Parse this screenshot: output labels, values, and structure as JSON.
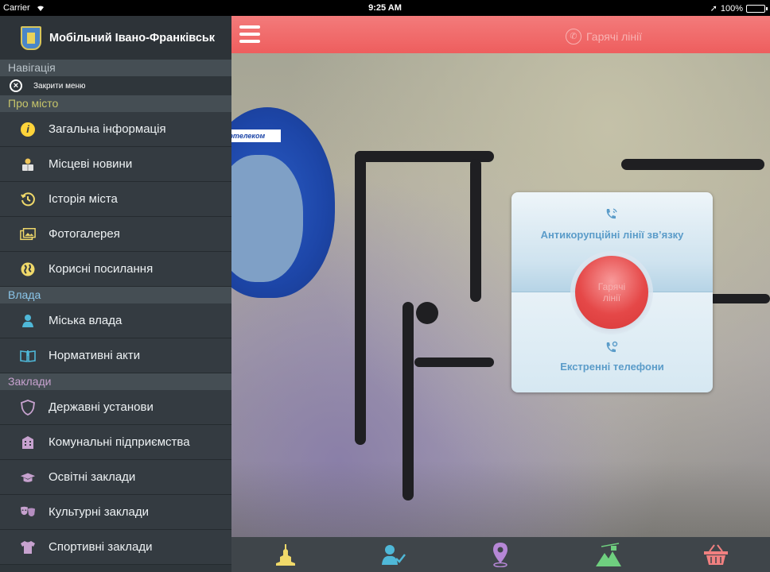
{
  "status_bar": {
    "carrier": "Carrier",
    "time": "9:25 AM",
    "battery": "100%"
  },
  "sidebar": {
    "app_title": "Мобільний Івано-Франківськ",
    "nav_section": "Навігація",
    "close_menu": "Закрити меню",
    "sections": [
      {
        "title": "Про місто",
        "items": [
          {
            "label": "Загальна інформація",
            "icon": "info-icon"
          },
          {
            "label": "Місцеві новини",
            "icon": "news-reader-icon"
          },
          {
            "label": "Історія міста",
            "icon": "history-clock-icon"
          },
          {
            "label": "Фотогалерея",
            "icon": "photo-gallery-icon"
          },
          {
            "label": "Корисні посилання",
            "icon": "globe-icon"
          }
        ]
      },
      {
        "title": "Влада",
        "items": [
          {
            "label": "Міська влада",
            "icon": "person-icon"
          },
          {
            "label": "Нормативні акти",
            "icon": "open-book-icon"
          }
        ]
      },
      {
        "title": "Заклади",
        "items": [
          {
            "label": "Державні установи",
            "icon": "shield-icon"
          },
          {
            "label": "Комунальні підприємства",
            "icon": "building-icon"
          },
          {
            "label": "Освітні заклади",
            "icon": "graduation-cap-icon"
          },
          {
            "label": "Культурні заклади",
            "icon": "theater-masks-icon"
          },
          {
            "label": "Спортивні заклади",
            "icon": "tshirt-icon"
          }
        ]
      }
    ]
  },
  "topbar": {
    "title": "Гарячі лінії"
  },
  "card": {
    "top_label": "Антикорупційні лінії зв’язку",
    "bottom_label": "Екстренні телефони",
    "center_button": "Гарячі лінії"
  },
  "colors": {
    "accent_red": "#ee5e5e",
    "card_blue": "#5b9cc9",
    "sidebar_bg": "#2f363b"
  },
  "tabbar": {
    "tabs": [
      {
        "name": "landmark-icon",
        "color": "#f0d96a"
      },
      {
        "name": "person-check-icon",
        "color": "#4fb8d8"
      },
      {
        "name": "map-pin-icon",
        "color": "#b687d6"
      },
      {
        "name": "mountain-cablecar-icon",
        "color": "#6fcf7f"
      },
      {
        "name": "shopping-basket-icon",
        "color": "#f08080"
      }
    ]
  }
}
